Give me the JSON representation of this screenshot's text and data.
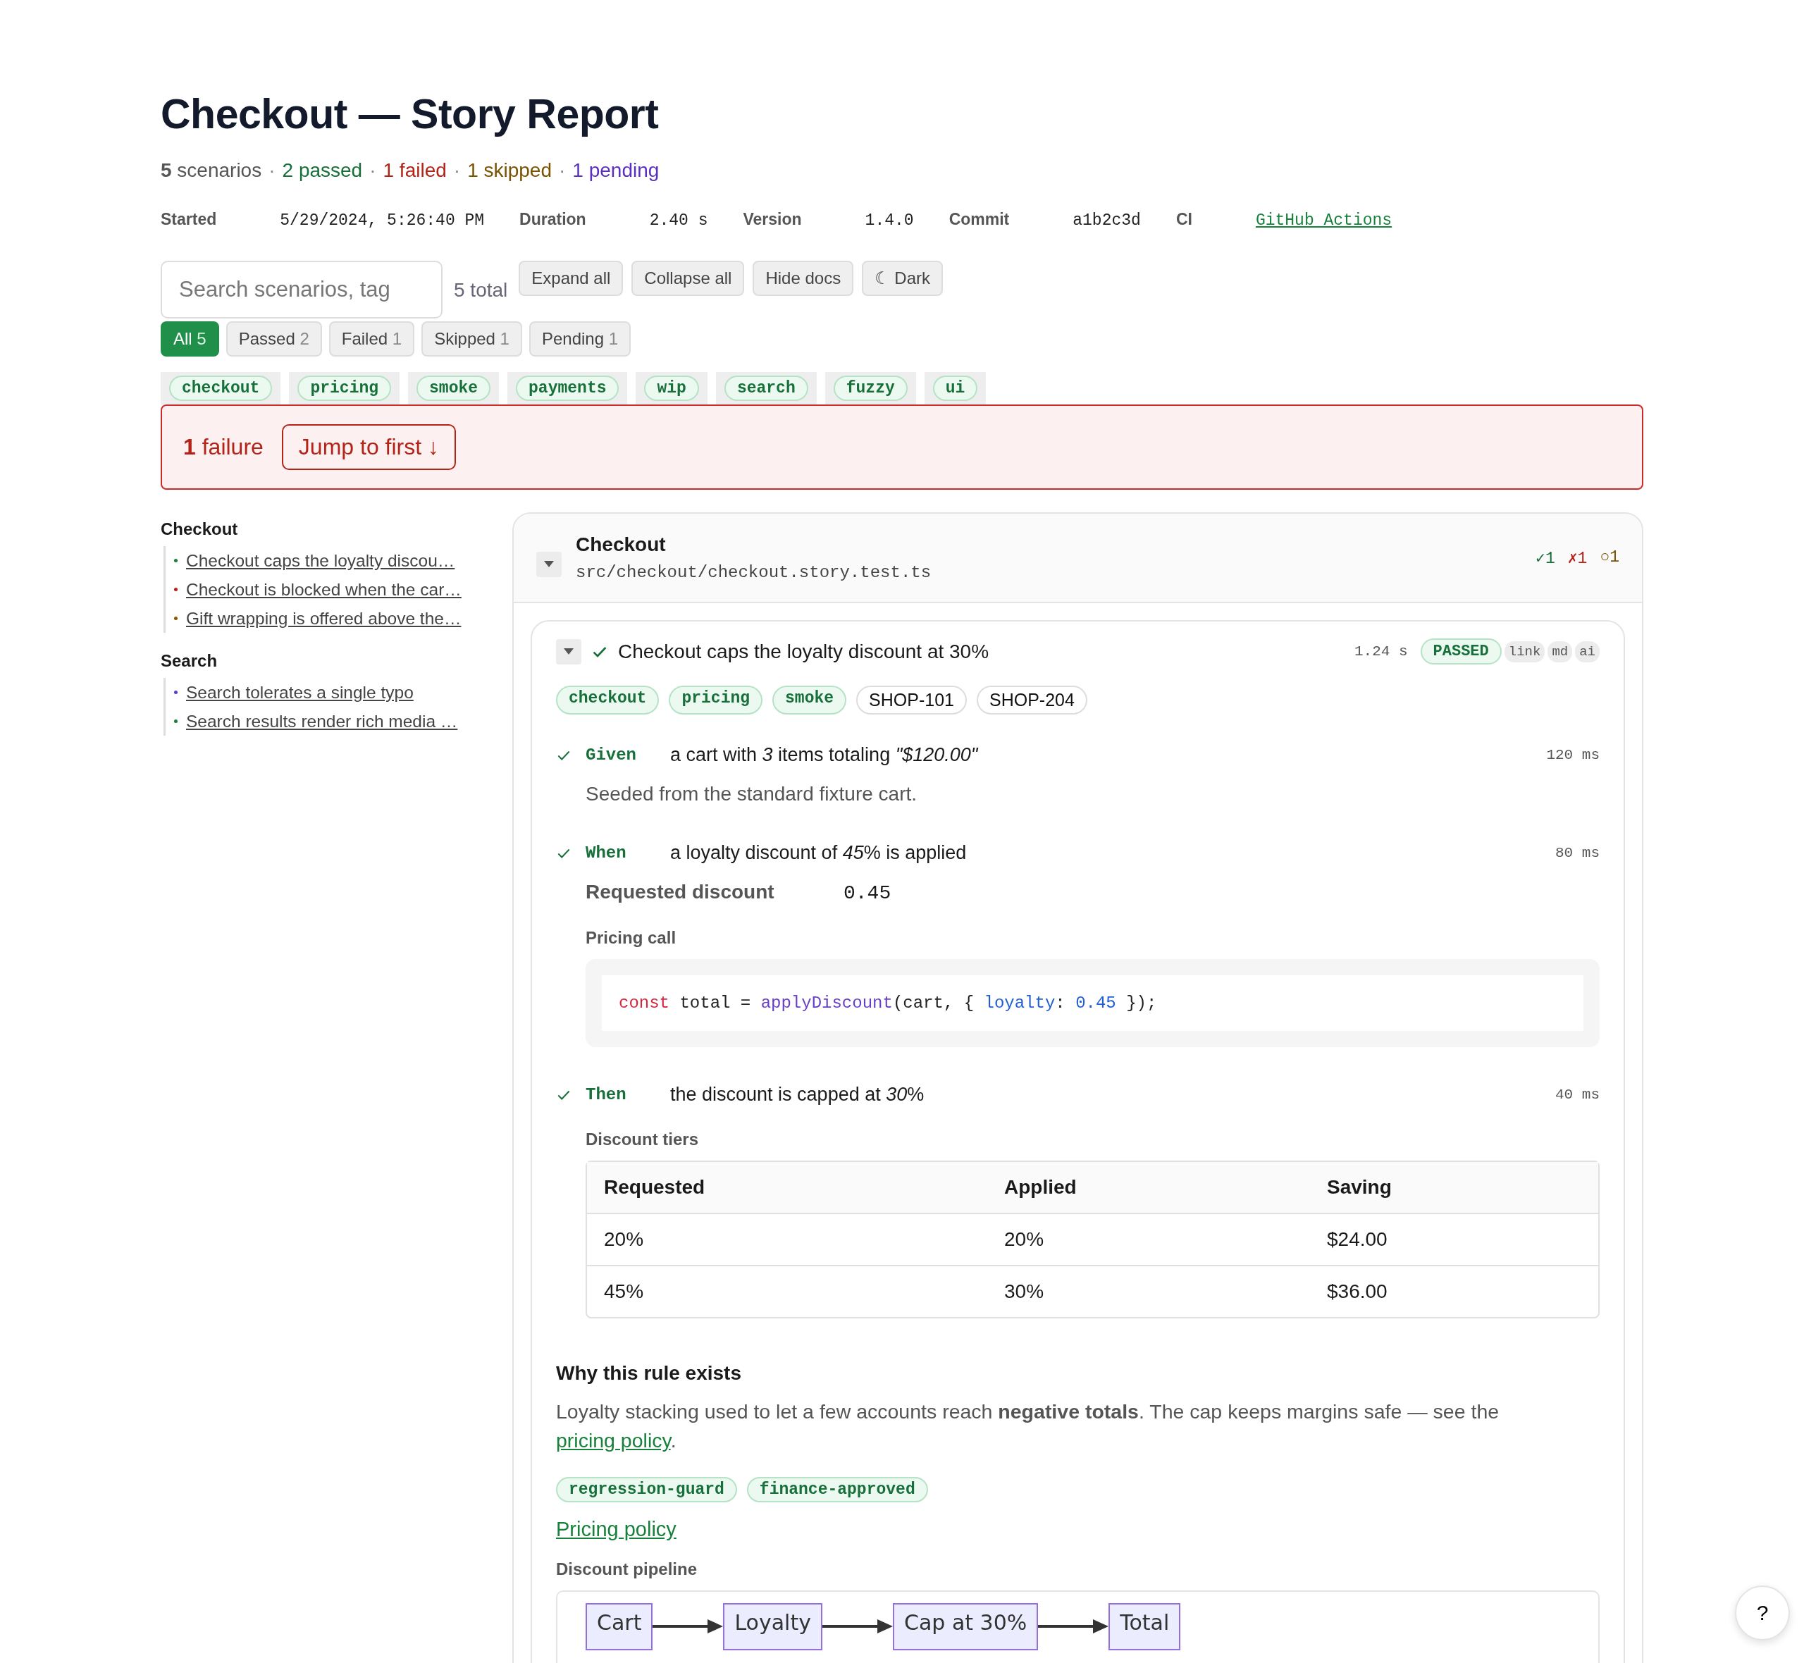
{
  "title": "Checkout — Story Report",
  "summary": {
    "separator": "·",
    "items": [
      {
        "kind": "total",
        "text": "**5** scenarios"
      },
      {
        "kind": "passed",
        "text": "2 passed"
      },
      {
        "kind": "failed",
        "text": "1 failed"
      },
      {
        "kind": "skipped",
        "text": "1 skipped"
      },
      {
        "kind": "pending",
        "text": "1 pending"
      }
    ]
  },
  "meta": [
    {
      "label": "Started",
      "value": "5/29/2024, 5:26:40 PM",
      "kind": "text"
    },
    {
      "label": "Duration",
      "value": "2.40 s",
      "kind": "text"
    },
    {
      "label": "Version",
      "value": "1.4.0",
      "kind": "text"
    },
    {
      "label": "Commit",
      "value": "a1b2c3d",
      "kind": "text"
    },
    {
      "label": "CI",
      "value": "GitHub Actions",
      "kind": "link"
    }
  ],
  "search": {
    "placeholder": "Search scenarios, tag"
  },
  "total": "5 total",
  "toolbar_buttons": [
    "Expand all",
    "Collapse all",
    "Hide docs",
    "☾ Dark"
  ],
  "filters": [
    {
      "label": "All",
      "count": "5",
      "selected": true
    },
    {
      "label": "Passed",
      "count": "2",
      "selected": false
    },
    {
      "label": "Failed",
      "count": "1",
      "selected": false
    },
    {
      "label": "Skipped",
      "count": "1",
      "selected": false
    },
    {
      "label": "Pending",
      "count": "1",
      "selected": false
    }
  ],
  "tags": [
    "checkout",
    "pricing",
    "smoke",
    "payments",
    "wip",
    "search",
    "fuzzy",
    "ui"
  ],
  "failure_banner": {
    "count": "1",
    "label": "failure",
    "button": "Jump to first ↓"
  },
  "sidebar": [
    {
      "title": "Checkout",
      "items": [
        {
          "label": "Checkout caps the loyalty discou…",
          "color": "#1a7f37"
        },
        {
          "label": "Checkout is blocked when the car…",
          "color": "#b42318"
        },
        {
          "label": "Gift wrapping is offered above the…",
          "color": "#8a5a00"
        }
      ]
    },
    {
      "title": "Search",
      "items": [
        {
          "label": "Search tolerates a single typo",
          "color": "#5b3cc4"
        },
        {
          "label": "Search results render rich media …",
          "color": "#1a7f37"
        }
      ]
    }
  ],
  "feature": {
    "title": "Checkout",
    "path": "src/checkout/checkout.story.test.ts",
    "expanded": true,
    "counts": [
      {
        "kind": "passed",
        "text": "✓1"
      },
      {
        "kind": "failed",
        "text": "✗1"
      },
      {
        "kind": "skipped",
        "text": "○1"
      }
    ],
    "scenario": {
      "title": "Checkout caps the loyalty discount at 30%",
      "expanded": true,
      "kind": "passed",
      "duration": "1.24 s",
      "badge": "PASSED",
      "links": [
        "link",
        "md",
        "ai"
      ],
      "tags": [
        {
          "label": "checkout",
          "kind": "tag"
        },
        {
          "label": "pricing",
          "kind": "tag"
        },
        {
          "label": "smoke",
          "kind": "tag"
        },
        {
          "label": "SHOP-101",
          "kind": "ticket"
        },
        {
          "label": "SHOP-204",
          "kind": "ticket"
        }
      ],
      "steps": [
        {
          "keyword": "Given",
          "kind": "passed",
          "text": "a cart with *3* items totaling *\"$120.00\"*",
          "duration": "120 ms",
          "extras": [
            {
              "kind": "note",
              "text": "Seeded from the standard fixture cart."
            }
          ]
        },
        {
          "keyword": "When",
          "kind": "passed",
          "text": "a loyalty discount of *45*% is applied",
          "duration": "80 ms",
          "extras": [
            {
              "kind": "kv",
              "label": "Requested discount",
              "value": "0.45"
            },
            {
              "kind": "code",
              "title": "Pricing call",
              "tokens": [
                {
                  "kind": "keyword",
                  "text": "const"
                },
                {
                  "kind": "plain",
                  "text": " total = "
                },
                {
                  "kind": "function",
                  "text": "applyDiscount"
                },
                {
                  "kind": "plain",
                  "text": "(cart, { "
                },
                {
                  "kind": "property",
                  "text": "loyalty"
                },
                {
                  "kind": "plain",
                  "text": ": "
                },
                {
                  "kind": "number",
                  "text": "0.45"
                },
                {
                  "kind": "plain",
                  "text": " });"
                }
              ]
            }
          ]
        },
        {
          "keyword": "Then",
          "kind": "passed",
          "text": "the discount is capped at *30*%",
          "duration": "40 ms",
          "extras": [
            {
              "kind": "table",
              "title": "Discount tiers",
              "columns": [
                "Requested",
                "Applied",
                "Saving"
              ],
              "rows": [
                [
                  "20%",
                  "20%",
                  "$24.00"
                ],
                [
                  "45%",
                  "30%",
                  "$36.00"
                ]
              ]
            }
          ]
        }
      ],
      "doc": {
        "heading": "Why this rule exists",
        "text": "Loyalty stacking used to let a few accounts reach **negative totals**. The cap keeps margins safe — see the ",
        "link": "pricing policy",
        "after": ".",
        "tags": [
          "regression-guard",
          "finance-approved"
        ],
        "link_block": "Pricing policy",
        "diagram": {
          "title": "Discount pipeline",
          "nodes": [
            "Cart",
            "Loyalty",
            "Cap at 30%",
            "Total"
          ]
        }
      }
    }
  },
  "help": "?"
}
